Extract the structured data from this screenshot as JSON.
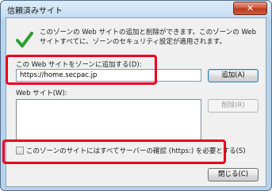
{
  "window": {
    "title": "信頼済みサイト",
    "close_glyph": "✕"
  },
  "intro_text": "このゾーンの Web サイトの追加と削除ができます。このゾーンの Web サイトすべてに、ゾーンのセキュリティ設定が適用されます。",
  "add_site": {
    "label": "この Web サイトをゾーンに追加する(D):",
    "value": "https://home.secpac.jp",
    "add_button": "追加(A)"
  },
  "websites": {
    "label": "Web サイト(W):",
    "items": [],
    "remove_button": "削除(R)"
  },
  "https_option": {
    "label": "このゾーンのサイトにはすべてサーバーの確認 (https:) を必要とする(S)",
    "checked": false
  },
  "close_button": "閉じる(C)",
  "icons": {
    "check": "check-icon"
  },
  "colors": {
    "highlight": "#e8001c",
    "check_green": "#2e9e2e"
  }
}
